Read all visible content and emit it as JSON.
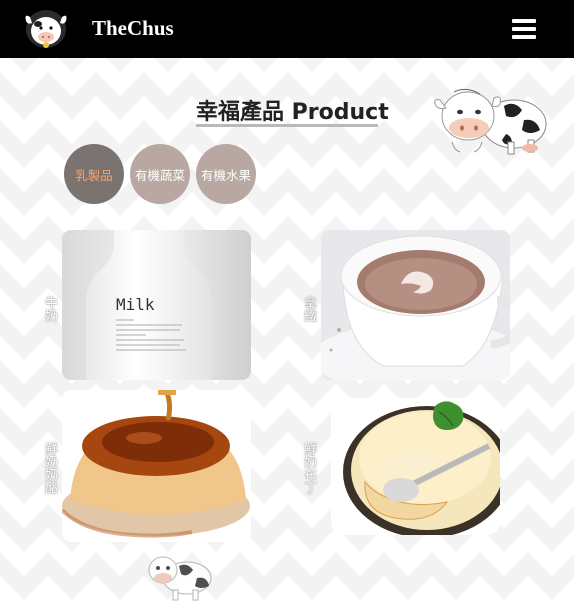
{
  "navbar": {
    "brand": "TheChus",
    "menu_icon": "hamburger-menu-icon",
    "logo_icon": "cow-logo-icon"
  },
  "section": {
    "title": "幸福產品 Product"
  },
  "categories": [
    {
      "label": "乳製品",
      "active": true
    },
    {
      "label": "有機蔬菜",
      "active": false
    },
    {
      "label": "有機水果",
      "active": false
    }
  ],
  "products": [
    {
      "name": "牛奶",
      "bottle_text": "Milk"
    },
    {
      "name": "拿鐵"
    },
    {
      "name": "鮮奶奶酪"
    },
    {
      "name": "鮮奶布丁"
    }
  ],
  "colors": {
    "nav_bg": "#000000",
    "active_category": "#7a7370",
    "category": "#b9a8a2",
    "active_text": "#ff9f6a"
  }
}
